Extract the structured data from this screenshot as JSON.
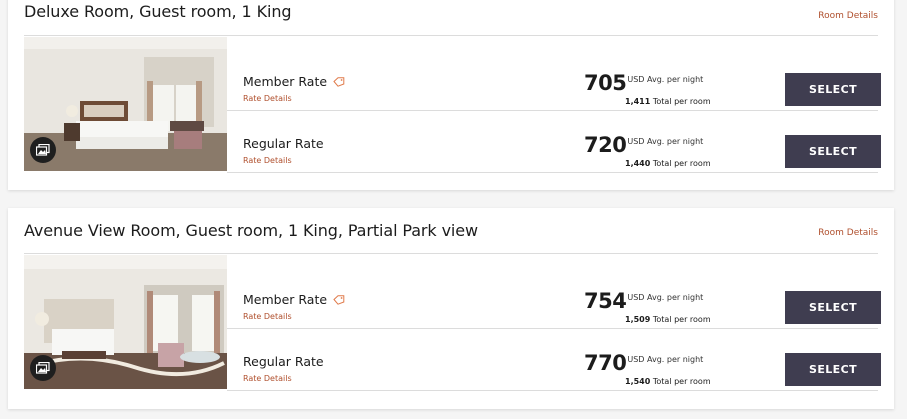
{
  "rooms": [
    {
      "title": "Deluxe Room, Guest room, 1 King",
      "room_details_label": "Room Details",
      "rates": [
        {
          "name": "Member Rate",
          "has_tag": true,
          "details_label": "Rate Details",
          "price": "705",
          "price_unit": "USD Avg. per night",
          "total_value": "1,411",
          "total_label": "Total per room",
          "select_label": "SELECT"
        },
        {
          "name": "Regular Rate",
          "has_tag": false,
          "details_label": "Rate Details",
          "price": "720",
          "price_unit": "USD Avg. per night",
          "total_value": "1,440",
          "total_label": "Total per room",
          "select_label": "SELECT"
        }
      ]
    },
    {
      "title": "Avenue View Room, Guest room, 1 King, Partial Park view",
      "room_details_label": "Room Details",
      "rates": [
        {
          "name": "Member Rate",
          "has_tag": true,
          "details_label": "Rate Details",
          "price": "754",
          "price_unit": "USD Avg. per night",
          "total_value": "1,509",
          "total_label": "Total per room",
          "select_label": "SELECT"
        },
        {
          "name": "Regular Rate",
          "has_tag": false,
          "details_label": "Rate Details",
          "price": "770",
          "price_unit": "USD Avg. per night",
          "total_value": "1,540",
          "total_label": "Total per room",
          "select_label": "SELECT"
        }
      ]
    }
  ],
  "colors": {
    "accent_link": "#b0502e",
    "select_button": "#3f3d50",
    "card_bg": "#ffffff",
    "page_bg": "#f5f5f5"
  },
  "icons": {
    "member_tag": "tag-icon",
    "gallery": "gallery-icon"
  }
}
